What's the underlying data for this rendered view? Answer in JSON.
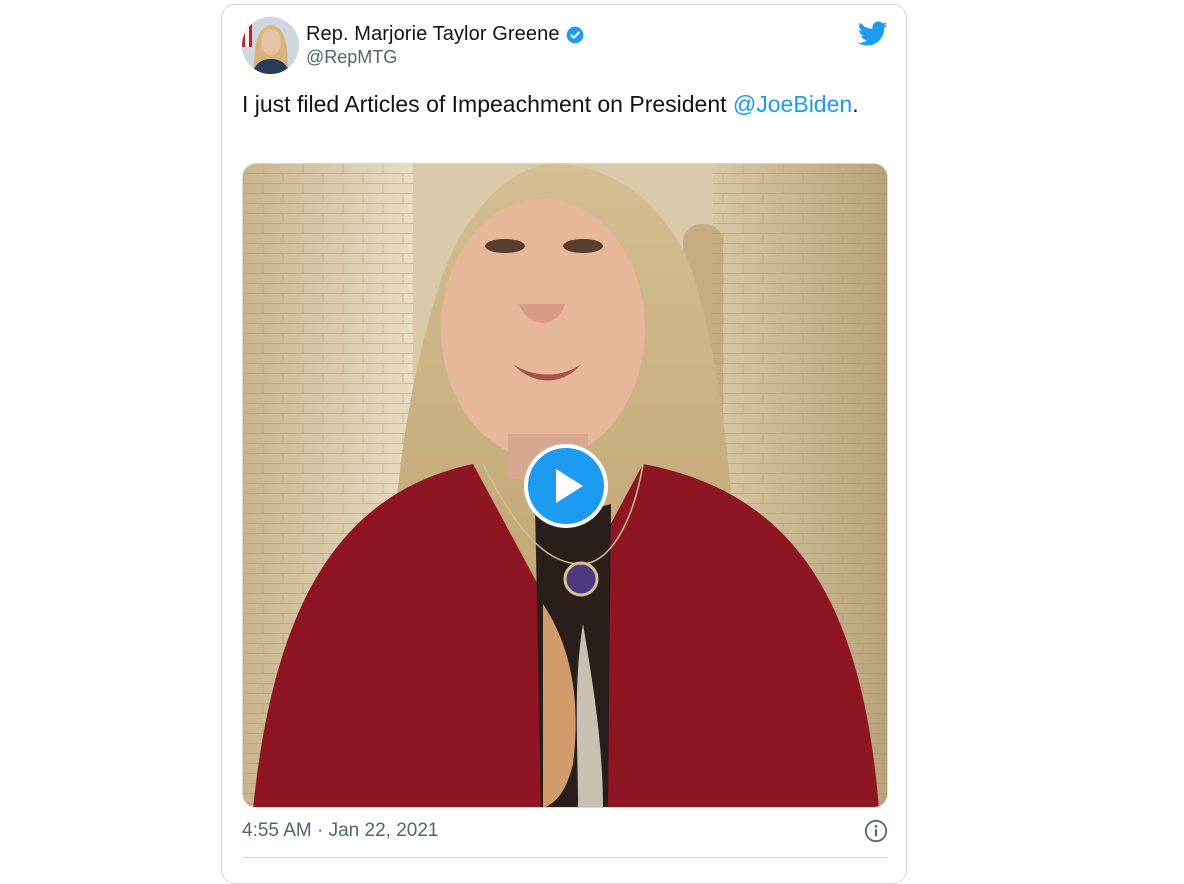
{
  "author": {
    "display_name": "Rep. Marjorie Taylor Greene",
    "handle": "@RepMTG",
    "verified": true,
    "avatar_icon": "profile-photo"
  },
  "tweet": {
    "text_before": "I just filed Articles of Impeachment on President",
    "mention": "@JoeBiden",
    "text_after": "."
  },
  "media": {
    "type": "video",
    "play_icon": "play-icon"
  },
  "meta": {
    "timestamp": "4:55 AM · Jan 22, 2021",
    "info_icon": "info-icon"
  },
  "colors": {
    "accent": "#1d9bf0",
    "text_primary": "#0f1419",
    "text_secondary": "#536471",
    "border": "#cfd9de"
  }
}
